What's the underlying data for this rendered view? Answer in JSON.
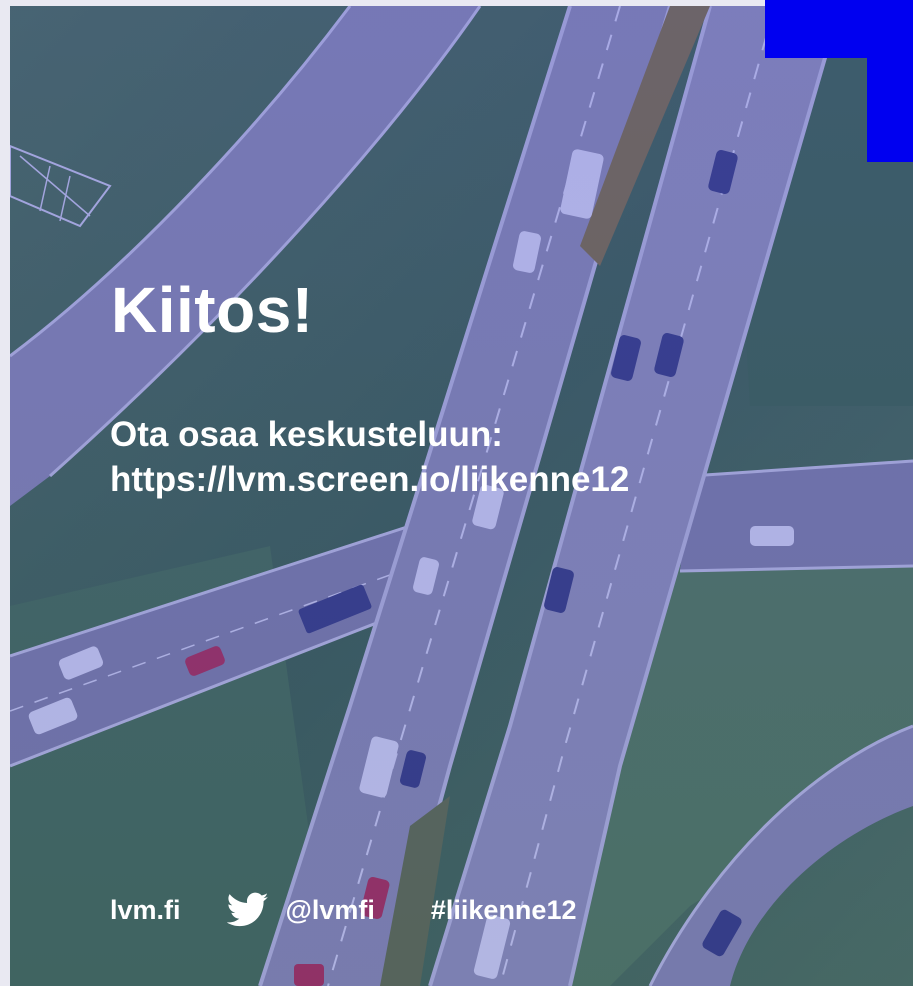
{
  "slide": {
    "title": "Kiitos!",
    "invite": "Ota osaa keskusteluun:",
    "link": "https://lvm.screen.io/liikenne12",
    "footer": {
      "website": "lvm.fi",
      "twitter_handle": "@lvmfi",
      "hashtag": "#liikenne12"
    }
  },
  "icons": {
    "social": "twitter-bird-icon"
  },
  "colors": {
    "accent": "#0000f0",
    "photo_tint": "#3a44c8",
    "text": "#ffffff"
  }
}
